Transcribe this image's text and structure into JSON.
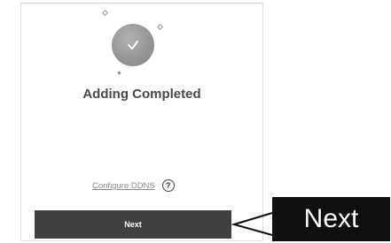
{
  "status": {
    "icon": "checkmark-icon",
    "title": "Adding Completed"
  },
  "links": {
    "configure_ddns": "Configure DDNS",
    "help_glyph": "?"
  },
  "actions": {
    "next_label": "Next"
  },
  "callout": {
    "label": "Next"
  },
  "colors": {
    "button_bg": "#404040",
    "callout_bg": "#0f0f0f",
    "title_text": "#4a4a4a",
    "icon_circle": "#959595"
  }
}
